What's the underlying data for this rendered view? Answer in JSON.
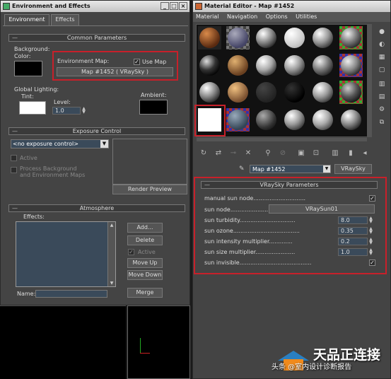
{
  "env": {
    "title": "Environment and Effects",
    "tabs": [
      "Environment",
      "Effects"
    ],
    "common": {
      "header": "Common Parameters",
      "background_label": "Background:",
      "color_label": "Color:",
      "env_map_label": "Environment Map:",
      "use_map_label": "Use Map",
      "map_button": "Map #1452  ( VRaySky )",
      "global_lighting_label": "Global Lighting:",
      "tint_label": "Tint:",
      "level_label": "Level:",
      "level_value": "1.0",
      "ambient_label": "Ambient:"
    },
    "exposure": {
      "header": "Exposure Control",
      "dropdown_value": "<no exposure control>",
      "active_label": "Active",
      "process_label_1": "Process Background",
      "process_label_2": "and Environment Maps",
      "render_preview": "Render Preview"
    },
    "atmosphere": {
      "header": "Atmosphere",
      "effects_label": "Effects:",
      "add": "Add...",
      "delete": "Delete",
      "active": "Active",
      "move_up": "Move Up",
      "move_down": "Move Down",
      "name_label": "Name:",
      "merge": "Merge"
    }
  },
  "mat": {
    "title": "Material Editor - Map #1452",
    "menu": [
      "Material",
      "Navigation",
      "Options",
      "Utilities"
    ],
    "map_name": "Map #1452",
    "map_type": "VRaySky",
    "params_header": "VRaySky Parameters",
    "params": {
      "manual_sun_node": "manual sun node.............................",
      "sun_node": "sun node.........................",
      "sun_node_value": "VRaySun01",
      "sun_turbidity": "sun turbidity...............................",
      "sun_turbidity_value": "8.0",
      "sun_ozone": "sun ozone.....................................",
      "sun_ozone_value": "0.35",
      "sun_intensity_multiplier": "sun intensity multiplier.............",
      "sun_intensity_multiplier_value": "0.2",
      "sun_size_multiplier": "sun size multiplier......................",
      "sun_size_multiplier_value": "1.0",
      "sun_invisible": "sun invisible........................................"
    }
  },
  "watermark": {
    "brand": "天品正连接",
    "sub": "头条 @室内设计诊断报告"
  },
  "colors": {
    "highlight_red": "#c8202a",
    "panel_bg": "#444444",
    "viewport_bg": "#000000"
  }
}
